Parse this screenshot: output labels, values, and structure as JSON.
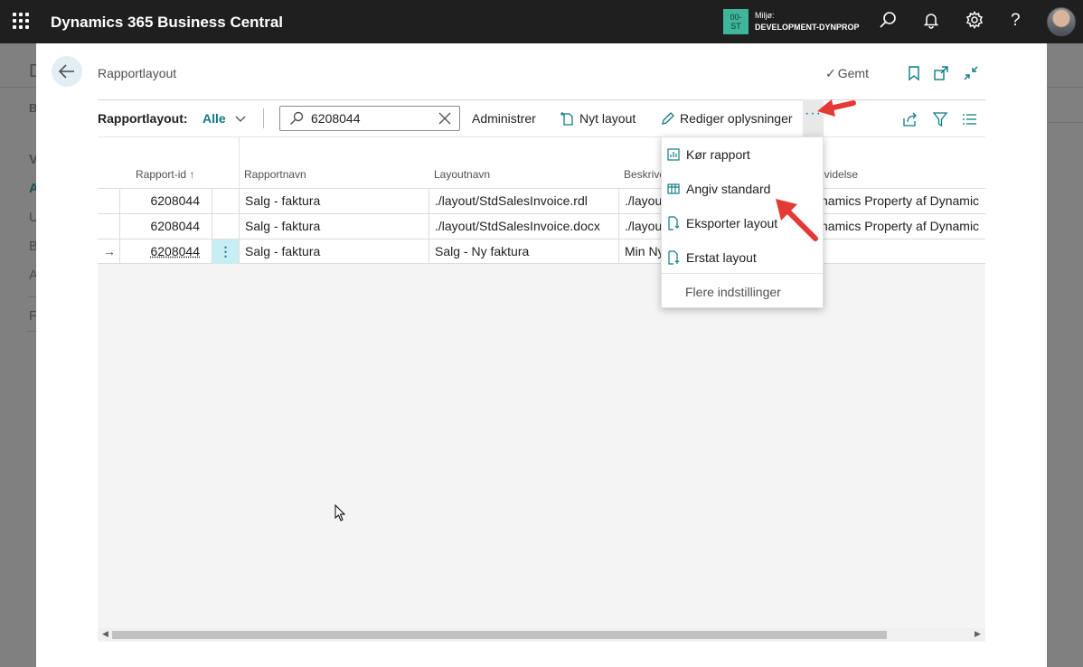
{
  "topbar": {
    "app_title": "Dynamics 365 Business Central",
    "env_badge": "00-ST",
    "env_badge_line1": "00-",
    "env_badge_line2": "ST",
    "env_caption": "Miljø:",
    "env_name": "DEVELOPMENT-DYNPROP",
    "icons": [
      "waffle-icon",
      "search-icon",
      "bell-icon",
      "gear-icon",
      "help-icon",
      "avatar"
    ]
  },
  "background_page": {
    "letters": [
      "D",
      "Bo",
      "V",
      "A",
      "U",
      "B",
      "A",
      "Fi"
    ]
  },
  "dialog": {
    "title": "Rapportlayout",
    "saved_label": "Gemt",
    "toolbar": {
      "label": "Rapportlayout:",
      "filter": "Alle",
      "search_value": "6208044",
      "manage": "Administrer",
      "new_layout": "Nyt layout",
      "edit_info": "Rediger oplysninger",
      "more": "···"
    },
    "columns": [
      "Rapport-id ↑",
      "Rapportnavn",
      "Layoutnavn",
      "Beskrive",
      "dvidelse"
    ],
    "rows": [
      {
        "id": "6208044",
        "report": "Salg - faktura",
        "layout": "./layout/StdSalesInvoice.rdl",
        "desc": "./layou",
        "ext": "ynamics Property af Dynamic"
      },
      {
        "id": "6208044",
        "report": "Salg - faktura",
        "layout": "./layout/StdSalesInvoice.docx",
        "desc": "./layou",
        "ext": "ynamics Property af Dynamic"
      },
      {
        "id": "6208044",
        "report": "Salg - faktura",
        "layout": "Salg - Ny faktura",
        "desc": "Min Ny",
        "ext": ""
      }
    ],
    "row_marker": "→",
    "row_action": "⋮"
  },
  "menu": {
    "items": [
      "Kør rapport",
      "Angiv standard",
      "Eksporter layout",
      "Erstat layout"
    ],
    "more_settings": "Flere indstillinger"
  },
  "colors": {
    "accent": "#0f7b83",
    "topbar": "#1f1f1f",
    "arrow": "#e53935",
    "env_badge": "#3fb69a"
  }
}
